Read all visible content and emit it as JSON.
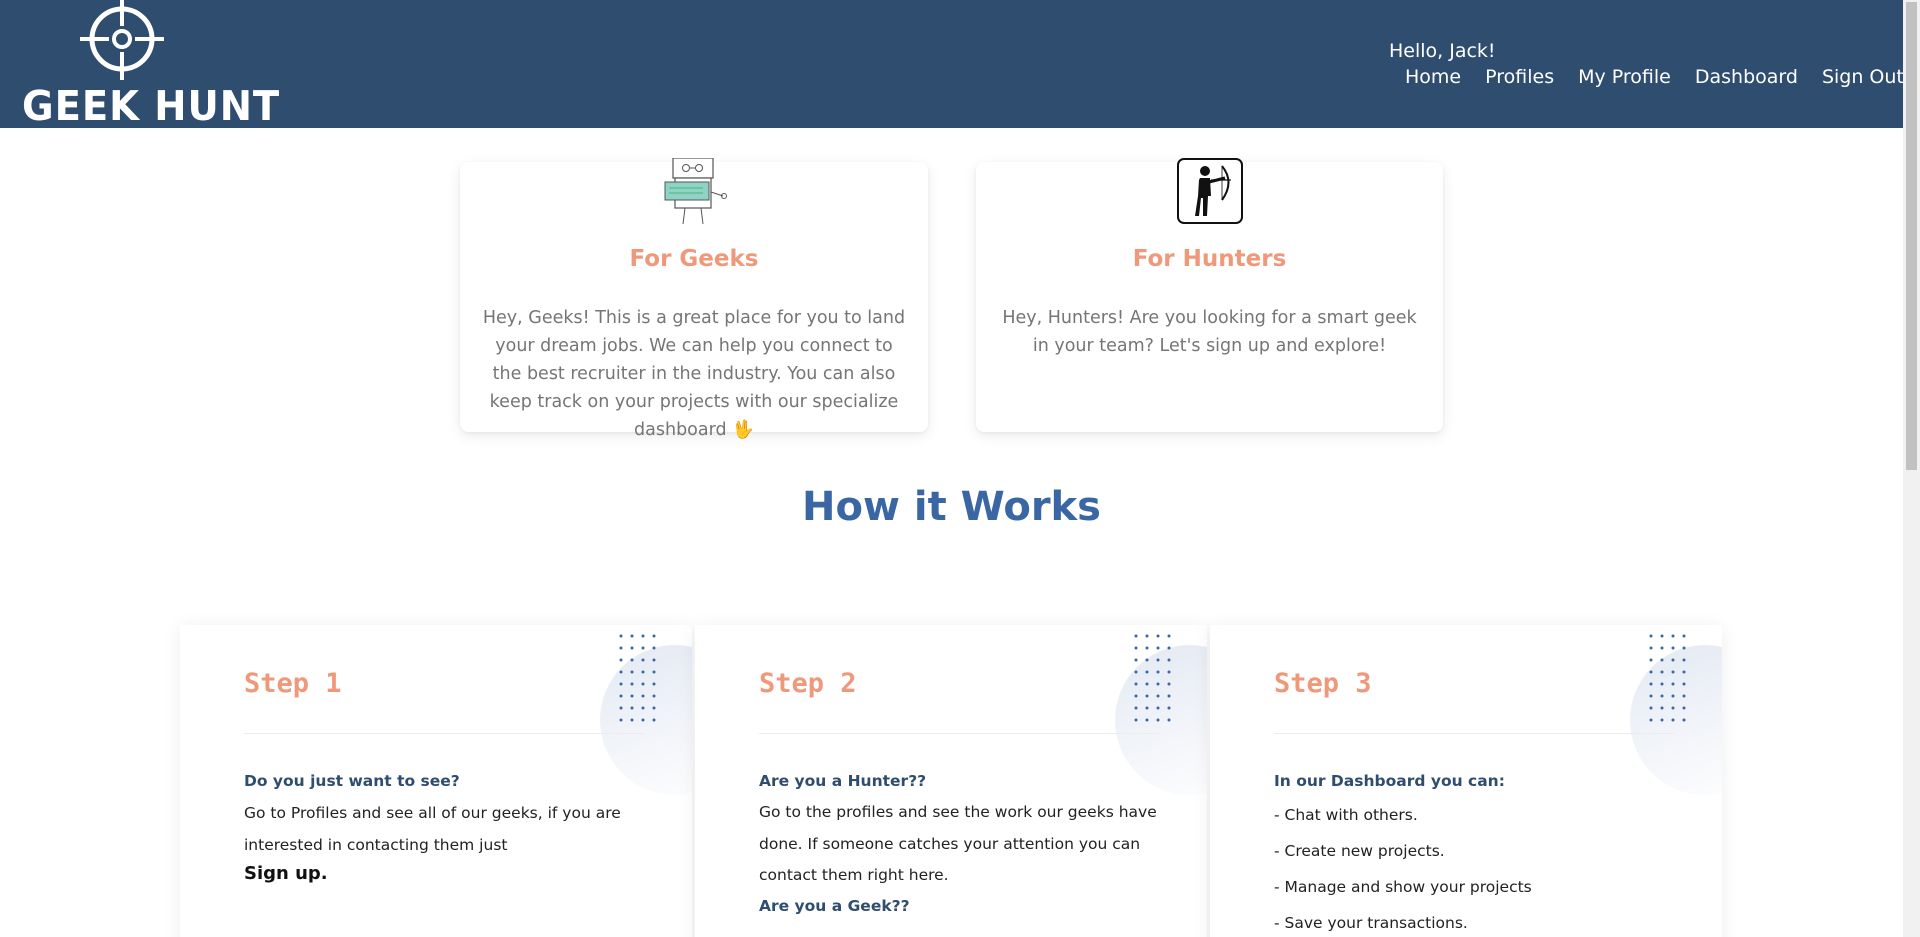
{
  "header": {
    "brand": "GEEK HUNT",
    "greeting": "Hello, Jack!",
    "nav": [
      {
        "label": "Home"
      },
      {
        "label": "Profiles"
      },
      {
        "label": "My Profile"
      },
      {
        "label": "Dashboard"
      },
      {
        "label": "Sign Out"
      }
    ]
  },
  "cards": {
    "geeks": {
      "title": "For Geeks",
      "text": "Hey, Geeks! This is a great place for you to land your dream jobs. We can help you connect to the best recruiter in the industry. You can also keep track on your projects with our specialize dashboard 🖖",
      "image_icon": "robot-holding-sign-icon"
    },
    "hunters": {
      "title": "For Hunters",
      "text": "Hey, Hunters! Are you looking for a smart geek in your team? Let's sign up and explore!",
      "image_icon": "archer-icon"
    }
  },
  "how_it_works": {
    "title": "How it Works",
    "steps": [
      {
        "title": "Step 1",
        "question": "Do you just want to see?",
        "text": "Go to Profiles and see all of our geeks, if you are interested in contacting them just",
        "strong": "Sign up."
      },
      {
        "title": "Step 2",
        "question": "Are you a Hunter??",
        "text": "Go to the profiles and see the work our geeks have done. If someone catches your attention you can contact them right here.",
        "question2": "Are you a Geek??"
      },
      {
        "title": "Step 3",
        "question": "In our Dashboard you can:",
        "items": [
          "- Chat with others.",
          "- Create new projects.",
          "- Manage and show your projects",
          "- Save your transactions."
        ]
      }
    ]
  },
  "colors": {
    "navbar": "#2f4d6f",
    "accent": "#f0997a",
    "heading": "#3a67a3",
    "question": "#2f4d6f"
  }
}
